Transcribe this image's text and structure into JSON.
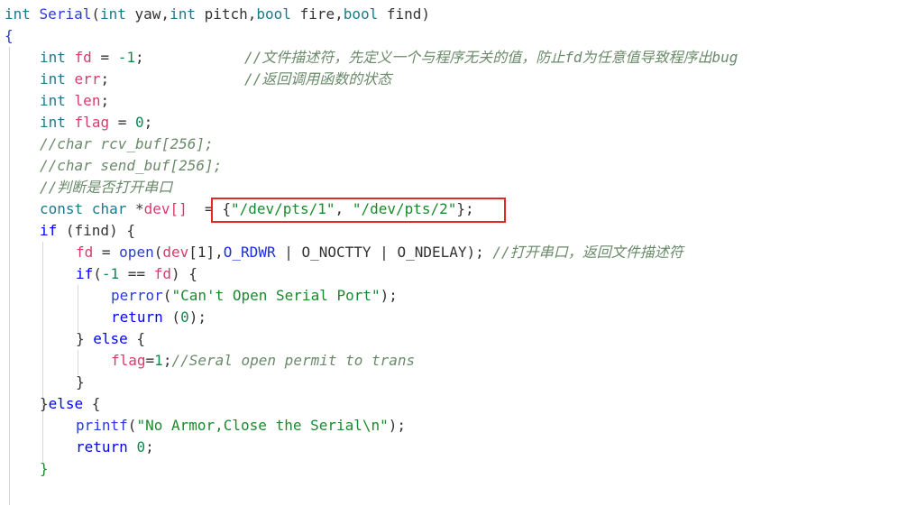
{
  "code": {
    "l1": {
      "kw_int": "int",
      "fname": "Serial",
      "p1": "(",
      "t1": "int",
      "a1": " yaw,",
      "t2": "int",
      "a2": " pitch,",
      "t3": "bool",
      "a3": " fire,",
      "t4": "bool",
      "a4": " find)"
    },
    "l2": {
      "brace": "{"
    },
    "l3": {
      "t": "int",
      "v": "fd",
      "eq": " = ",
      "n": "-1",
      "semi": ";",
      "c": "//文件描述符，先定义一个与程序无关的值，防止fd为任意值导致程序出bug"
    },
    "l4": {
      "t": "int",
      "v": "err",
      "semi": ";",
      "c": "//返回调用函数的状态"
    },
    "l5": {
      "t": "int",
      "v": "len",
      "semi": ";"
    },
    "l6": {
      "t": "int",
      "v": "flag",
      "eq": " = ",
      "n": "0",
      "semi": ";"
    },
    "l7": {
      "c": "//char rcv_buf[256];"
    },
    "l8": {
      "c": "//char send_buf[256];"
    },
    "l9": {
      "c": "//判断是否打开串口"
    },
    "l10": {
      "t1": "const",
      "t2": " char ",
      "star": "*",
      "v": "dev[]",
      "rest1": "  = {",
      "s1": "\"/dev/pts/1\"",
      "comma": ", ",
      "s2": "\"/dev/pts/2\"",
      "end": "};"
    },
    "l11": {
      "kw": "if",
      "rest": " (find) {"
    },
    "l12": {
      "v": "fd",
      "eq": " = ",
      "fn": "open",
      "p": "(",
      "v2": "dev",
      "idx": "[1],",
      "m1": "O_RDWR",
      "bar1": " | ",
      "m2": "O_NOCTTY",
      "bar2": " | ",
      "m3": "O_NDELAY",
      "end": "); ",
      "c": "//打开串口，返回文件描述符"
    },
    "l13": {
      "kw": "if",
      "p": "(",
      "n": "-1",
      "mid": " == ",
      "v": "fd",
      "end": ") {"
    },
    "l14": {
      "fn": "perror",
      "p": "(",
      "s": "\"Can't Open Serial Port\"",
      "end": ");"
    },
    "l15": {
      "kw": "return",
      "p": " (",
      "n": "0",
      "end": ");"
    },
    "l16": {
      "a": "} ",
      "kw": "else",
      "b": " {"
    },
    "l17": {
      "v": "flag",
      "eq": "=",
      "n": "1",
      "semi": ";",
      "c": "//Seral open permit to trans"
    },
    "l18": {
      "brace": "}"
    },
    "l19": {
      "a": "}",
      "kw": "else",
      "b": " {"
    },
    "l20": {
      "fn": "printf",
      "p": "(",
      "s": "\"No Armor,Close the Serial\\n\"",
      "end": ");"
    },
    "l21": {
      "kw": "return",
      "sp": " ",
      "n": "0",
      "semi": ";"
    },
    "l22": {
      "brace": "}"
    }
  }
}
